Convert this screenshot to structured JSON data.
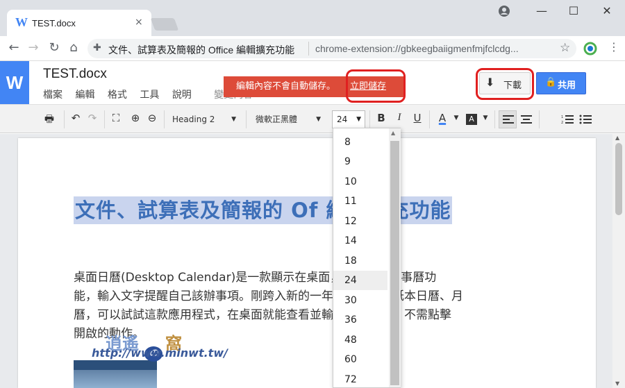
{
  "browser": {
    "tab_title": "TEST.docx",
    "tab_favicon": "W",
    "tab_close": "×",
    "omnibox_title": "文件、試算表及簡報的 Office 編輯擴充功能",
    "omnibox_url": "chrome-extension://gbkeegbaiigmenfmjfclcdg...",
    "window_min": "—",
    "window_max": "☐",
    "window_close": "✕"
  },
  "app": {
    "logo": "W",
    "doc_title": "TEST.docx",
    "menu": [
      "檔案",
      "編輯",
      "格式",
      "工具",
      "說明"
    ],
    "menu_extra": "變更內容",
    "warning_text": "編輯內容不會自動儲存。",
    "warning_link": "立即儲存",
    "download_label": "下載",
    "share_label": "共用"
  },
  "toolbar": {
    "style_select": "Heading 2",
    "font_select": "微軟正黑體",
    "size_select": "24",
    "bold": "B",
    "italic": "I",
    "underline": "U",
    "text_color": "A",
    "highlight": "A"
  },
  "font_sizes": {
    "options": [
      "8",
      "9",
      "10",
      "11",
      "12",
      "14",
      "18",
      "24",
      "30",
      "36",
      "48",
      "60",
      "72"
    ],
    "selected": "24"
  },
  "document": {
    "heading": "文件、試算表及簡報的 Of 編輯擴充功能",
    "paragraph_lines": [
      "桌面日曆(Desktop Calendar)是一款顯示在桌面，同時兼具行事曆功",
      "能，輸入文字提醒自己該辦事項。剛跨入新的一年，缺少一份紙本日曆、月",
      "曆，可以試試這款應用程式，在桌面就能查看並輸入備忘事項，不需點擊",
      "開啟的動作。"
    ],
    "watermark_url": "http://www.minwt.tw/",
    "watermark_title": "逍遙",
    "watermark_circle": "の",
    "watermark_char": "窩"
  },
  "colors": {
    "brand_blue": "#4285f4",
    "warning_red": "#dd4b39",
    "highlight_ring": "#e02020",
    "heading_text": "#3d6fb8",
    "heading_highlight": "#c9d4ee"
  },
  "icons": [
    "word-logo-icon",
    "back-icon",
    "forward-icon",
    "reload-icon",
    "home-icon",
    "extension-icon",
    "star-icon",
    "account-icon",
    "menu-icon",
    "print-icon",
    "undo-icon",
    "redo-icon",
    "fit-icon",
    "zoom-in-icon",
    "zoom-out-icon",
    "download-icon",
    "lock-icon",
    "align-left-icon",
    "align-center-icon",
    "numbered-list-icon",
    "bullet-list-icon"
  ]
}
